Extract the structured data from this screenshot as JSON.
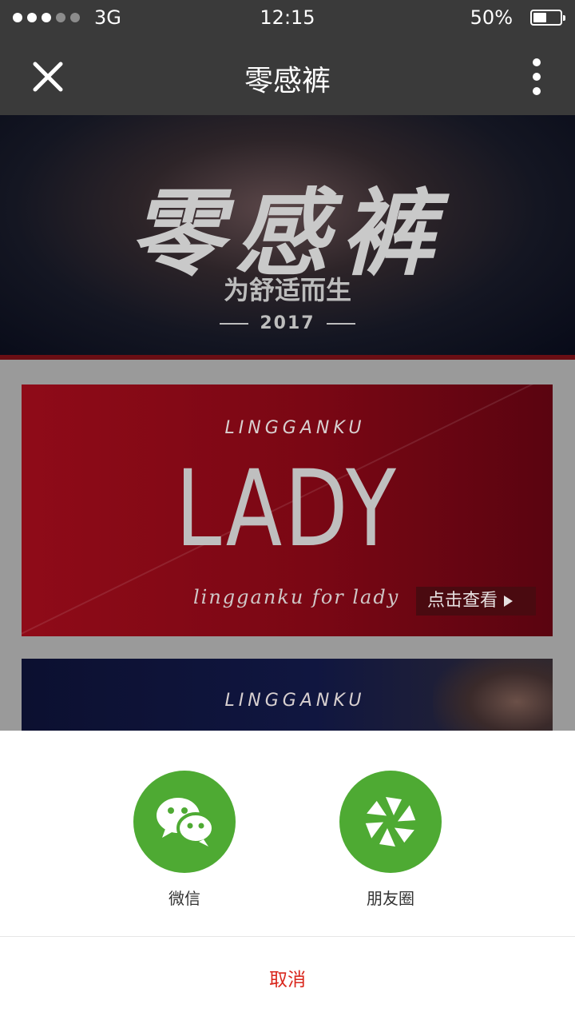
{
  "status_bar": {
    "network": "3G",
    "time": "12:15",
    "battery": "50%",
    "battery_level": 0.5
  },
  "nav": {
    "title": "零感裤"
  },
  "hero": {
    "title": "零感裤",
    "subtitle": "为舒适而生",
    "year": "2017"
  },
  "lady_card": {
    "arc_text": "LINGGANKU",
    "title": "LADY",
    "script": "lingganku  for  lady",
    "view_button": "点击查看"
  },
  "men_card": {
    "arc_text": "LINGGANKU"
  },
  "share_sheet": {
    "items": [
      {
        "label": "微信",
        "icon": "wechat-icon"
      },
      {
        "label": "朋友圈",
        "icon": "moments-icon"
      }
    ],
    "cancel": "取消"
  },
  "colors": {
    "accent_green": "#4eaa33",
    "cancel_red": "#d9261c",
    "bar_dark": "#3a3a3a"
  }
}
